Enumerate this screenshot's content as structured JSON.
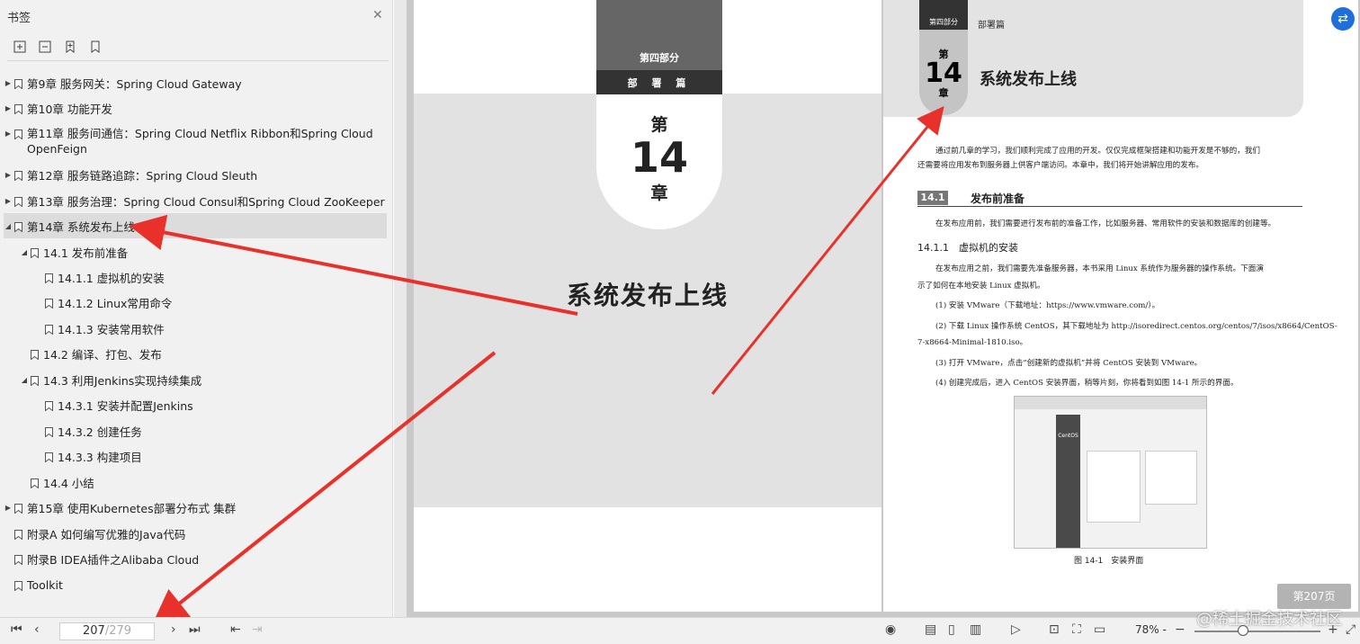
{
  "sidebar": {
    "title": "书签",
    "close": "✕",
    "items": [
      {
        "label": "第9章 服务网关：Spring Cloud Gateway",
        "expand": "▶"
      },
      {
        "label": "第10章 功能开发",
        "expand": "▶"
      },
      {
        "label": "第11章 服务间通信：Spring Cloud Netflix Ribbon和Spring Cloud OpenFeign",
        "expand": "▶"
      },
      {
        "label": "第12章 服务链路追踪：Spring Cloud Sleuth",
        "expand": "▶"
      },
      {
        "label": "第13章 服务治理：Spring Cloud Consul和Spring Cloud ZooKeeper",
        "expand": "▶"
      },
      {
        "label": "第14章 系统发布上线",
        "expand": "◢"
      },
      {
        "label": "14.1 发布前准备",
        "expand": "◢"
      },
      {
        "label": "14.1.1 虚拟机的安装",
        "expand": ""
      },
      {
        "label": "14.1.2 Linux常用命令",
        "expand": ""
      },
      {
        "label": "14.1.3 安装常用软件",
        "expand": ""
      },
      {
        "label": "14.2 编译、打包、发布",
        "expand": ""
      },
      {
        "label": "14.3 利用Jenkins实现持续集成",
        "expand": "◢"
      },
      {
        "label": "14.3.1 安装并配置Jenkins",
        "expand": ""
      },
      {
        "label": "14.3.2 创建任务",
        "expand": ""
      },
      {
        "label": "14.3.3 构建项目",
        "expand": ""
      },
      {
        "label": "14.4 小结",
        "expand": ""
      },
      {
        "label": "第15章 使用Kubernetes部署分布式 集群",
        "expand": "▶"
      },
      {
        "label": "附录A 如何编写优雅的Java代码",
        "expand": ""
      },
      {
        "label": "附录B IDEA插件之Alibaba Cloud",
        "expand": ""
      },
      {
        "label": "Toolkit",
        "expand": ""
      }
    ]
  },
  "left_page": {
    "part": "第四部分",
    "section": "部 署 篇",
    "di": "第",
    "num": "14",
    "zhang": "章",
    "title": "系统发布上线"
  },
  "right_page": {
    "part": "第四部分",
    "bu": "部署篇",
    "di": "第",
    "num": "14",
    "zhang": "章",
    "title": "系统发布上线",
    "intro1": "通过前几章的学习，我们顺利完成了应用的开发。仅仅完成框架搭建和功能开发是不够的，我们",
    "intro2": "还需要将应用发布到服务器上供客户端访问。本章中，我们将开始讲解应用的发布。",
    "sec_num": "14.1",
    "sec_title": "发布前准备",
    "p1": "在发布应用前，我们需要进行发布前的准备工作，比如服务器、常用软件的安装和数据库的创建等。",
    "sub": "14.1.1　虚拟机的安装",
    "p2a": "在发布应用之前，我们需要先准备服务器，本书采用 Linux 系统作为服务器的操作系统。下面演",
    "p2b": "示了如何在本地安装 Linux 虚拟机。",
    "s1": "(1) 安装 VMware（下载地址：https://www.vmware.com/）。",
    "s2a": "(2) 下载 Linux 操作系统 CentOS，其下载地址为 http://isoredirect.centos.org/centos/7/isos/x8664/CentOS-",
    "s2b": "7-x8664-Minimal-1810.iso。",
    "s3": "(3) 打开 VMware，点击“创建新的虚拟机”并将 CentOS 安装到 VMware。",
    "s4": "(4) 创建完成后，进入 CentOS 安装界面，稍等片刻，你将看到如图 14-1 所示的界面。",
    "fig_caption": "图 14-1　安装界面",
    "fig_brand": "CentOS"
  },
  "page_badge": "第207页",
  "corner_icon": "translate-icon",
  "bottom": {
    "current_page": "207",
    "total_pages": "/279",
    "zoom": "78%",
    "zoom_suffix": "-",
    "watermark": "@稀土掘金技术社区"
  },
  "colors": {
    "arrow": "#e8312a",
    "accent": "#1e6fd9"
  }
}
